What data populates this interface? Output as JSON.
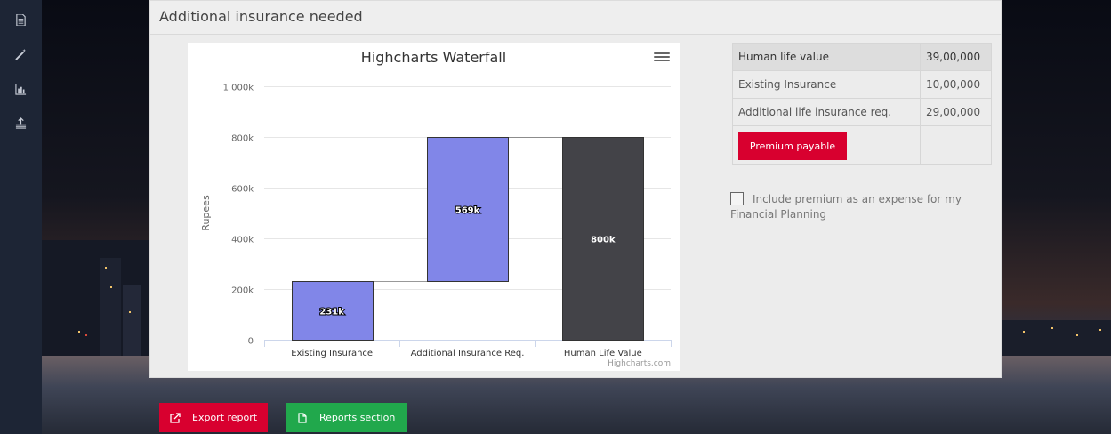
{
  "panel": {
    "title": "Additional insurance needed"
  },
  "sidebar": {
    "items": [
      {
        "icon": "document-icon"
      },
      {
        "icon": "magic-wand-icon"
      },
      {
        "icon": "bar-chart-icon"
      },
      {
        "icon": "upload-stack-icon"
      }
    ]
  },
  "chart_data": {
    "type": "waterfall",
    "title": "Highcharts Waterfall",
    "ylabel": "Rupees",
    "xlabel": "",
    "categories": [
      "Existing Insurance",
      "Additional Insurance Req.",
      "Human Life Value"
    ],
    "values": [
      231000,
      569000,
      800000
    ],
    "data_labels": [
      "231k",
      "569k",
      "800k"
    ],
    "ylim": [
      0,
      1000000
    ],
    "yticks": [
      0,
      200000,
      400000,
      600000,
      800000,
      1000000
    ],
    "ytick_labels": [
      "0",
      "200k",
      "400k",
      "600k",
      "800k",
      "1 000k"
    ],
    "colors": {
      "up": "#8186e8",
      "sum": "#434348"
    },
    "legend": "none",
    "grid": true,
    "credit": "Highcharts.com"
  },
  "summary": {
    "rows": [
      {
        "label": "Human life value",
        "value": "39,00,000"
      },
      {
        "label": "Existing Insurance",
        "value": "10,00,000"
      },
      {
        "label": "Additional life insurance req.",
        "value": "29,00,000"
      }
    ],
    "premium_button": "Premium payable",
    "include_premium_label": "Include premium as an expense for my Financial Planning"
  },
  "actions": {
    "export_label": "Export report",
    "reports_label": "Reports section"
  },
  "colors": {
    "accent_red": "#d8002f",
    "accent_green": "#21a84c",
    "sidebar": "#1d2535"
  }
}
